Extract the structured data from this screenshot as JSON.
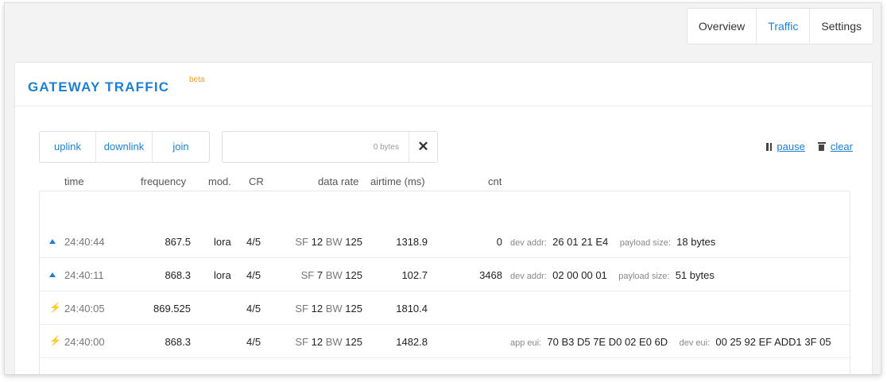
{
  "tabs": [
    {
      "label": "Overview",
      "active": false
    },
    {
      "label": "Traffic",
      "active": true
    },
    {
      "label": "Settings",
      "active": false
    }
  ],
  "panel": {
    "title": "GATEWAY TRAFFIC",
    "badge": "beta"
  },
  "filters": [
    "uplink",
    "downlink",
    "join"
  ],
  "search": {
    "placeholder": "0 bytes",
    "clear_icon": "close-icon"
  },
  "controls": {
    "pause_label": "pause",
    "clear_label": "clear"
  },
  "columns": {
    "time": "time",
    "frequency": "frequency",
    "mod": "mod.",
    "cr": "CR",
    "data_rate": "data rate",
    "airtime": "airtime (ms)",
    "cnt": "cnt"
  },
  "colors": {
    "accent": "#1f7fcf",
    "join_green": "#3cc46a",
    "join_orange": "#f0a020"
  },
  "rows": [
    {
      "icon": "arrow-up-icon",
      "time": "24:40:44",
      "frequency": "867.5",
      "mod": "lora",
      "cr": "4/5",
      "sf_label": "SF",
      "sf": "12",
      "bw_label": "BW",
      "bw": "125",
      "airtime": "1318.9",
      "cnt": "0",
      "k1": "dev addr:",
      "v1": "26 01 21 E4",
      "k2": "payload size:",
      "v2": "18 bytes"
    },
    {
      "icon": "arrow-up-icon",
      "time": "24:40:11",
      "frequency": "868.3",
      "mod": "lora",
      "cr": "4/5",
      "sf_label": "SF",
      "sf": "7",
      "bw_label": "BW",
      "bw": "125",
      "airtime": "102.7",
      "cnt": "3468",
      "k1": "dev addr:",
      "v1": "02 00 00 01",
      "k2": "payload size:",
      "v2": "51 bytes"
    },
    {
      "icon": "bolt-green-icon",
      "time": "24:40:05",
      "frequency": "869.525",
      "mod": "",
      "cr": "4/5",
      "sf_label": "SF",
      "sf": "12",
      "bw_label": "BW",
      "bw": "125",
      "airtime": "1810.4",
      "cnt": "",
      "k1": "",
      "v1": "",
      "k2": "",
      "v2": ""
    },
    {
      "icon": "bolt-orange-icon",
      "time": "24:40:00",
      "frequency": "868.3",
      "mod": "",
      "cr": "4/5",
      "sf_label": "SF",
      "sf": "12",
      "bw_label": "BW",
      "bw": "125",
      "airtime": "1482.8",
      "cnt": "",
      "k1": "app eui:",
      "v1": "70 B3 D5 7E D0 02 E0 6D",
      "k2": "dev eui:",
      "v2": "00 25 92 EF ADD1 3F 05"
    }
  ]
}
